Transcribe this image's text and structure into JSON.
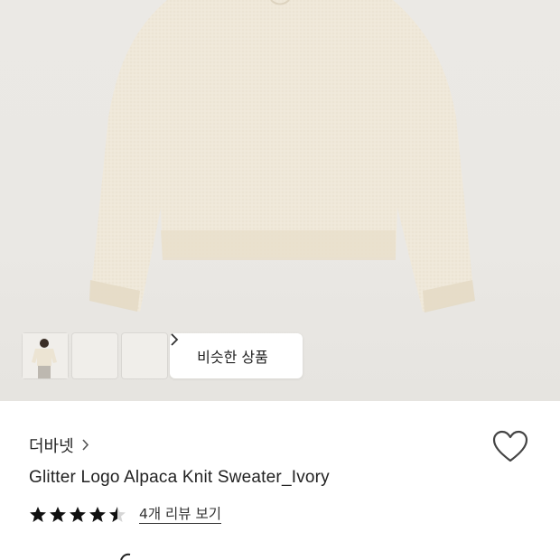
{
  "gallery": {
    "thumbnails": [
      {
        "alt": "sweater-flat-lay"
      },
      {
        "alt": "model-front"
      },
      {
        "alt": "model-side"
      }
    ],
    "similar_button": {
      "label": "비슷한 상품",
      "icon": "chevron-right-icon"
    }
  },
  "product": {
    "brand": "더바넷",
    "brand_icon": "chevron-right-icon",
    "title": "Glitter Logo Alpaca Knit Sweater_Ivory",
    "rating": 4.5,
    "rating_max": 5,
    "review_link": "4개 리뷰 보기",
    "wishlist_icon": "heart-outline-icon"
  },
  "colors": {
    "sweater": "#efe8d8",
    "hero_background": "#ebe9e5",
    "star": "#111111"
  }
}
